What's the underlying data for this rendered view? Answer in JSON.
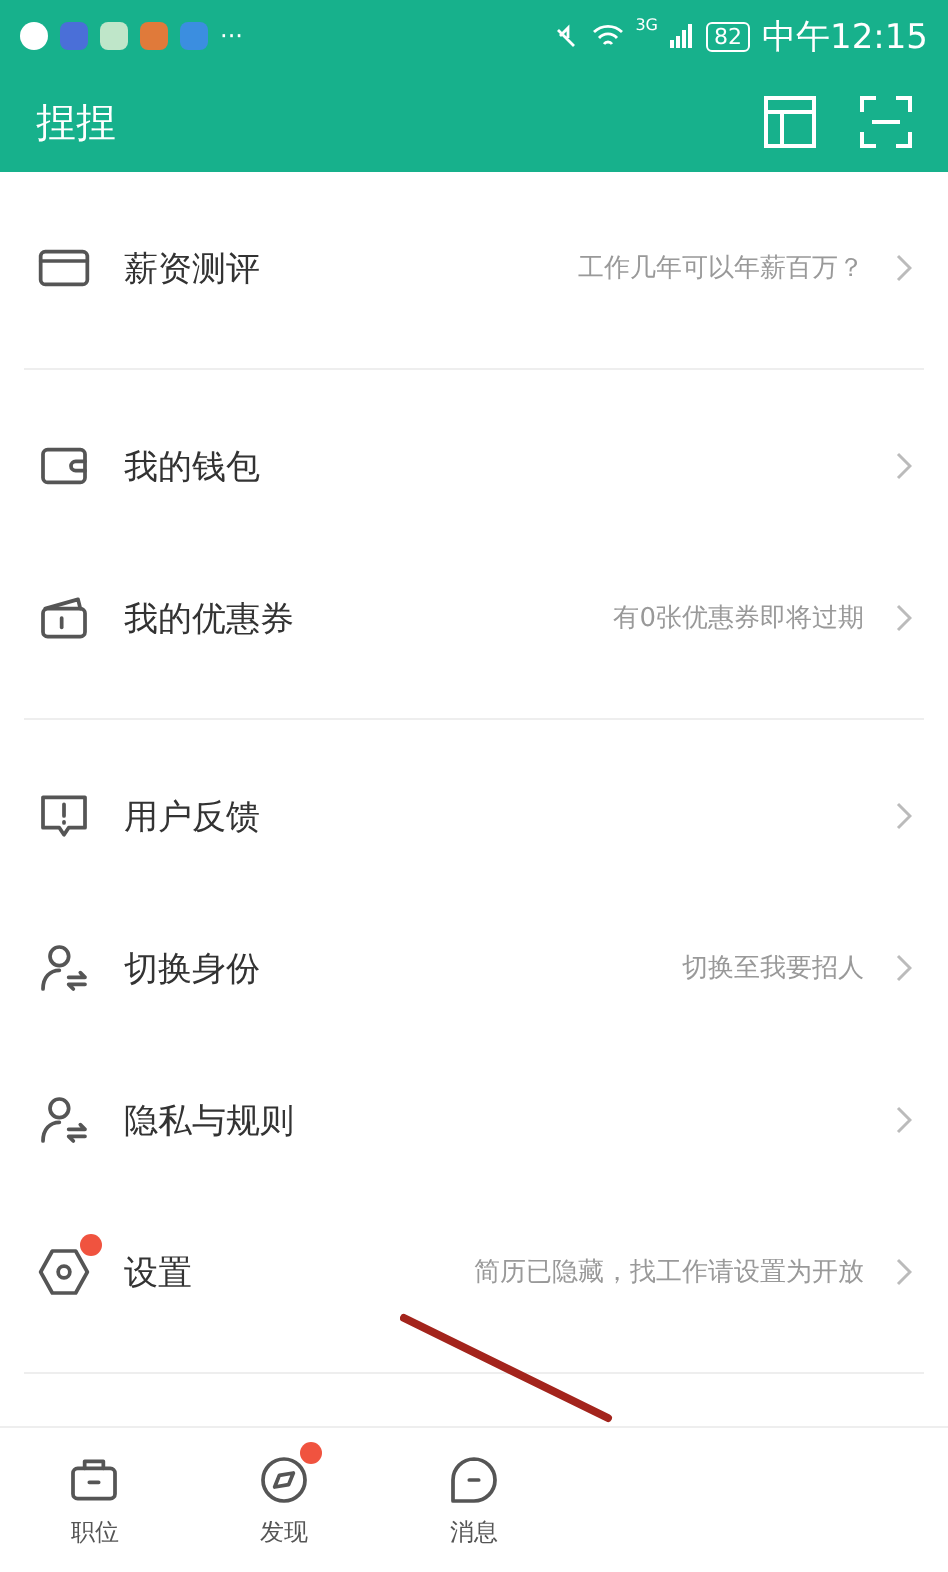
{
  "status_bar": {
    "more": "···",
    "network": "3G",
    "battery": "82",
    "time": "中午12:15"
  },
  "header": {
    "title": "捏捏"
  },
  "groups": [
    {
      "items": [
        {
          "kind": "card",
          "label": "薪资测评",
          "hint": "工作几年可以年薪百万？",
          "dot": false
        }
      ]
    },
    {
      "items": [
        {
          "kind": "wallet",
          "label": "我的钱包",
          "dot": false
        },
        {
          "kind": "coupon",
          "label": "我的优惠券",
          "hint": "有0张优惠券即将过期",
          "dot": false
        }
      ]
    },
    {
      "items": [
        {
          "kind": "feedback",
          "label": "用户反馈",
          "dot": false
        },
        {
          "kind": "switch",
          "label": "切换身份",
          "hint": "切换至我要招人",
          "dot": false
        },
        {
          "kind": "switch",
          "label": "隐私与规则",
          "dot": false
        },
        {
          "kind": "settings",
          "label": "设置",
          "hint": "简历已隐藏，找工作请设置为开放",
          "dot": true
        }
      ]
    }
  ],
  "tabs": [
    {
      "kind": "jobs",
      "label": "职位",
      "selected": false,
      "dot": false
    },
    {
      "kind": "discover",
      "label": "发现",
      "selected": false,
      "dot": true
    },
    {
      "kind": "messages",
      "label": "消息",
      "selected": false,
      "dot": false
    }
  ]
}
